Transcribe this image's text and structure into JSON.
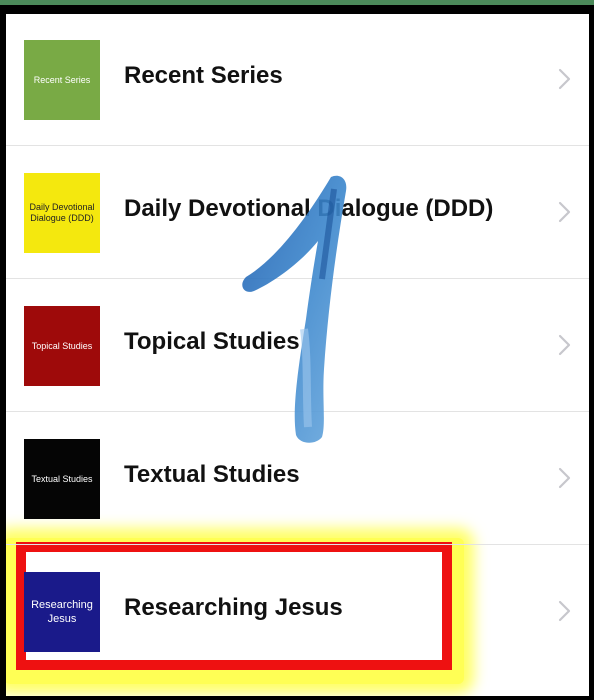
{
  "colors": {
    "page_background": "#ffffff",
    "highlight_border": "#ee1111",
    "highlight_glow": "#ffff55",
    "chevron": "#c7c7cc",
    "overlay_numeral": "#2f6fb8"
  },
  "list": {
    "items": [
      {
        "label": "Recent Series",
        "thumb_text": "Recent Series",
        "thumb_bg": "#79aa45",
        "thumb_fg": "#ffffff"
      },
      {
        "label": "Daily Devotional Dialogue (DDD)",
        "thumb_text": "Daily Devotional Dialogue (DDD)",
        "thumb_bg": "#f4e80e",
        "thumb_fg": "#222222"
      },
      {
        "label": "Topical Studies",
        "thumb_text": "Topical Studies",
        "thumb_bg": "#9e0a0a",
        "thumb_fg": "#ffffff"
      },
      {
        "label": "Textual Studies",
        "thumb_text": "Textual Studies",
        "thumb_bg": "#050505",
        "thumb_fg": "#ffffff"
      },
      {
        "label": "Researching Jesus",
        "thumb_text": "Researching Jesus",
        "thumb_bg": "#1a1a8a",
        "thumb_fg": "#ffffff"
      }
    ],
    "chevron_icon": "chevron-right-icon"
  },
  "annotation": {
    "step_number": "1"
  }
}
